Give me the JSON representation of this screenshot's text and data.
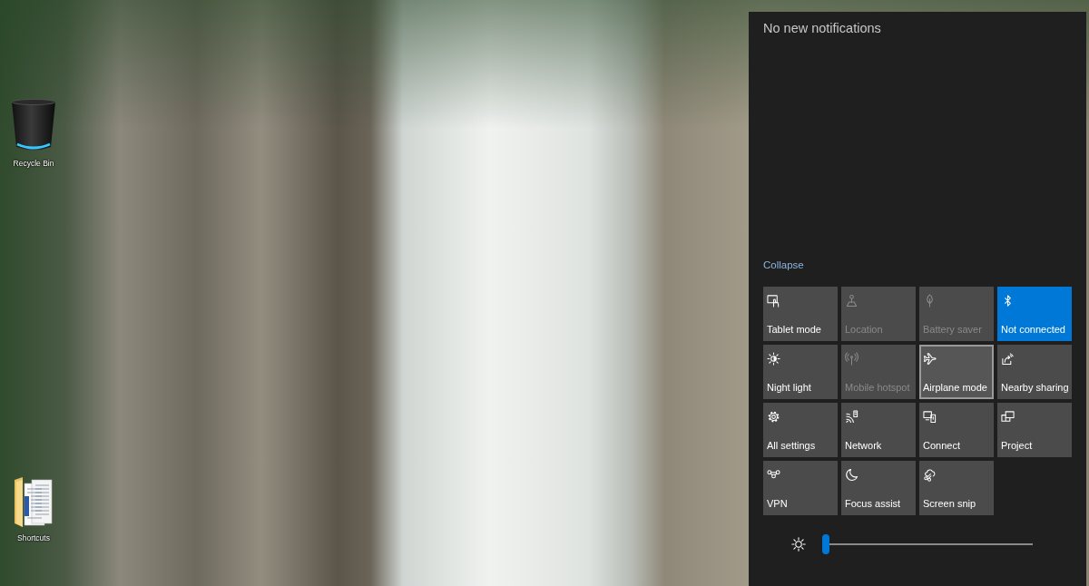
{
  "desktop": {
    "icons": [
      {
        "label": "Recycle Bin"
      },
      {
        "label": "Shortcuts"
      }
    ]
  },
  "action_center": {
    "notifications_header": "No new notifications",
    "collapse_link": "Collapse",
    "quick_actions": [
      {
        "label": "Tablet mode",
        "on": false,
        "disabled": false,
        "hovered": false
      },
      {
        "label": "Location",
        "on": false,
        "disabled": true,
        "hovered": false
      },
      {
        "label": "Battery saver",
        "on": false,
        "disabled": true,
        "hovered": false
      },
      {
        "label": "Not connected",
        "on": true,
        "disabled": false,
        "hovered": false
      },
      {
        "label": "Night light",
        "on": false,
        "disabled": false,
        "hovered": false
      },
      {
        "label": "Mobile hotspot",
        "on": false,
        "disabled": true,
        "hovered": false
      },
      {
        "label": "Airplane mode",
        "on": false,
        "disabled": false,
        "hovered": true
      },
      {
        "label": "Nearby sharing",
        "on": false,
        "disabled": false,
        "hovered": false
      },
      {
        "label": "All settings",
        "on": false,
        "disabled": false,
        "hovered": false
      },
      {
        "label": "Network",
        "on": false,
        "disabled": false,
        "hovered": false
      },
      {
        "label": "Connect",
        "on": false,
        "disabled": false,
        "hovered": false
      },
      {
        "label": "Project",
        "on": false,
        "disabled": false,
        "hovered": false
      },
      {
        "label": "VPN",
        "on": false,
        "disabled": false,
        "hovered": false
      },
      {
        "label": "Focus assist",
        "on": false,
        "disabled": false,
        "hovered": false
      },
      {
        "label": "Screen snip",
        "on": false,
        "disabled": false,
        "hovered": false
      }
    ],
    "brightness": {
      "level": 0
    }
  }
}
